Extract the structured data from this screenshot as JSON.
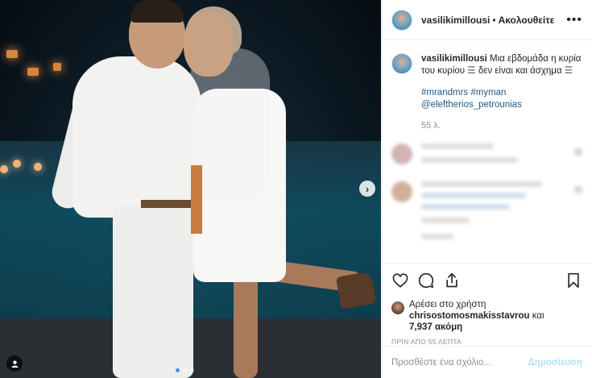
{
  "post": {
    "username": "vasilikimillousi",
    "separator": "•",
    "follow_label": "Ακολουθείτε",
    "more_label": "•••",
    "caption_user": "vasilikimillousi",
    "caption_text": "Μια εβδομάδα η κυρία του κυρίου",
    "caption_emoji1": "☰",
    "caption_mid": "δεν είναι και άσχημα",
    "caption_emoji2": "☰",
    "hashtags": "#mrandmrs #myman",
    "mention": "@eleftherios_petrounias",
    "caption_age": "55 λ."
  },
  "actions": {
    "liked_by_prefix": "Αρέσει στο χρήστη",
    "liked_by_user": "chrisostomosmakisstavrou",
    "liked_by_and": "και",
    "liked_by_count": "7,937 ακόμη",
    "timestamp": "ΠΡΙΝ ΑΠΟ 55 ΛΕΠΤΑ"
  },
  "comment_box": {
    "placeholder": "Προσθέστε ένα σχόλιο...",
    "post_label": "Δημοσίευση"
  },
  "carousel": {
    "next_label": "›",
    "slide_count": 3,
    "active_slide": 1
  },
  "colors": {
    "link": "#1f5a8a",
    "post_button": "#b2dffc",
    "muted": "#8e8e8e"
  }
}
